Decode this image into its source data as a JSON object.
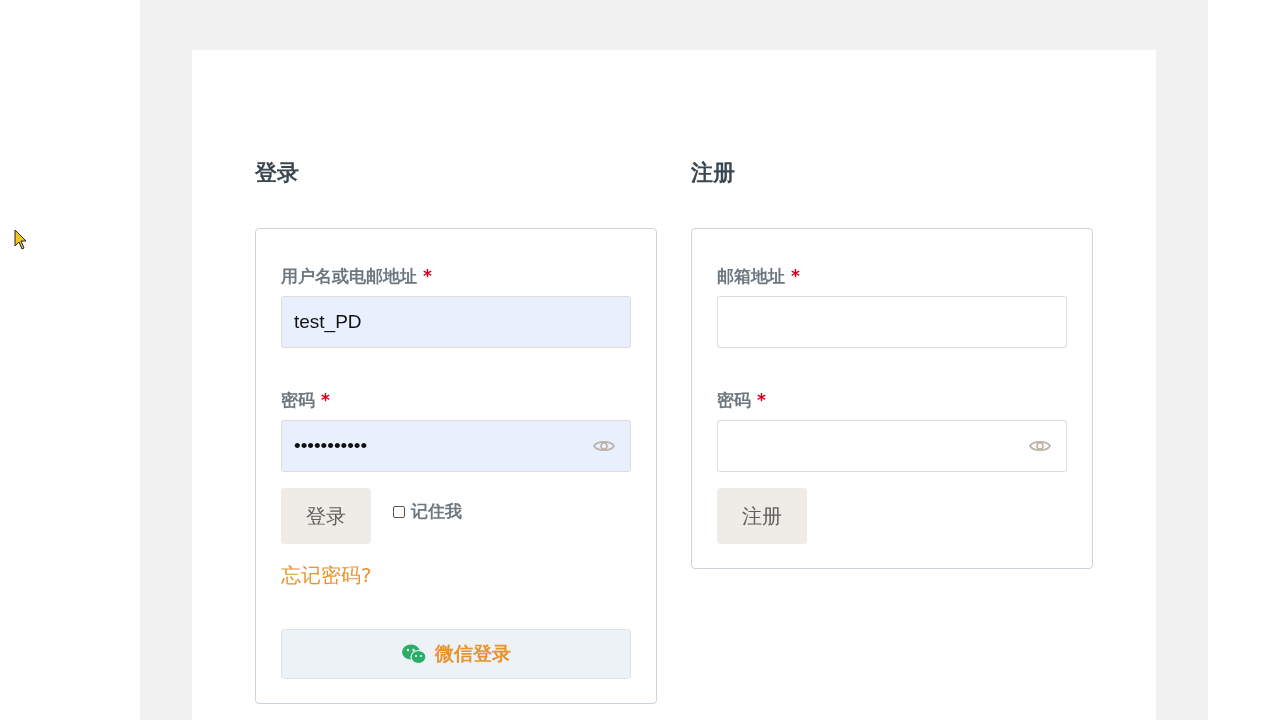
{
  "login": {
    "title": "登录",
    "fields": [
      {
        "kind": "text",
        "label": "用户名或电邮地址",
        "mark": "*",
        "value": "test_PD",
        "autofilled": true
      },
      {
        "kind": "password",
        "label": "密码",
        "mark": "*",
        "value": "•••••••••••",
        "autofilled": true
      }
    ],
    "submit": "登录",
    "remember": {
      "label": "记住我",
      "checked": false
    },
    "forgot": "忘记密码?",
    "wechat": "微信登录"
  },
  "register": {
    "title": "注册",
    "fields": [
      {
        "kind": "text",
        "label": "邮箱地址",
        "mark": "*",
        "autofilled": false
      },
      {
        "kind": "password",
        "label": "密码",
        "mark": "*",
        "autofilled": false
      }
    ],
    "submit": "注册"
  }
}
